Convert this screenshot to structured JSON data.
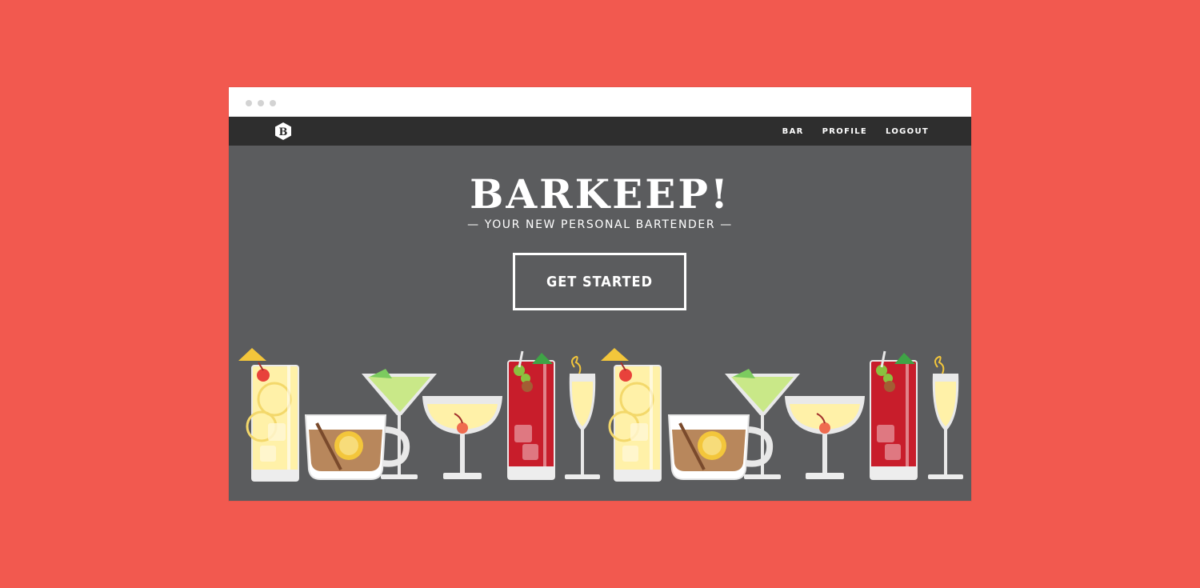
{
  "nav": {
    "logo_letter": "B",
    "links": [
      {
        "label": "BAR"
      },
      {
        "label": "PROFILE"
      },
      {
        "label": "LOGOUT"
      }
    ]
  },
  "hero": {
    "title": "BARKEEP!",
    "subtitle": "— YOUR NEW PERSONAL BARTENDER —",
    "cta_label": "GET STARTED"
  },
  "colors": {
    "page_background": "#f2594f",
    "hero_background": "#5b5c5e",
    "navbar": "#2e2e2e"
  },
  "illustration": {
    "drinks": [
      "highball-lemon",
      "hot-toddy-mug",
      "martini",
      "coupe-cherry",
      "red-cocktail-mint",
      "champagne-flute",
      "highball-lemon",
      "hot-toddy-mug",
      "martini",
      "coupe-cherry",
      "red-cocktail-mint",
      "champagne-flute"
    ]
  }
}
